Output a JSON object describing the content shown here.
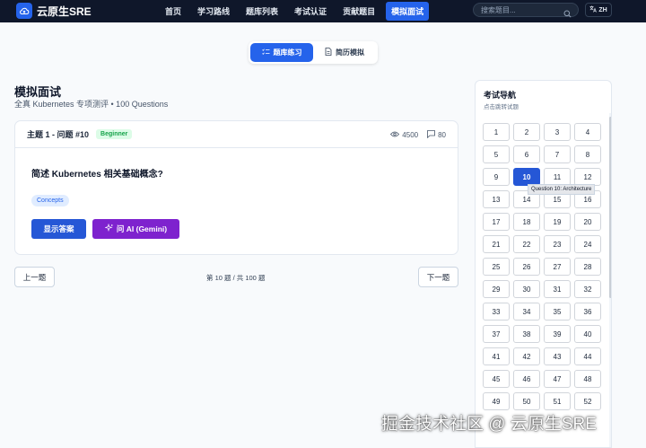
{
  "brand": {
    "name": "云原生SRE"
  },
  "nav": {
    "items": [
      {
        "label": "首页"
      },
      {
        "label": "学习路线"
      },
      {
        "label": "题库列表"
      },
      {
        "label": "考试认证"
      },
      {
        "label": "贡献题目"
      },
      {
        "label": "模拟面试"
      }
    ],
    "active_index": 5,
    "search_placeholder": "搜索题目...",
    "lang_label": "ZH"
  },
  "tabs": {
    "items": [
      {
        "label": "题库练习",
        "icon": "list-check-icon"
      },
      {
        "label": "简历模拟",
        "icon": "document-icon"
      }
    ],
    "active_index": 0
  },
  "header": {
    "title": "模拟面试",
    "subtitle": "全真 Kubernetes 专项测评 • 100 Questions"
  },
  "question": {
    "heading": "主题 1 - 问题 #10",
    "level": "Beginner",
    "views": "4500",
    "comments": "80",
    "text": "简述 Kubernetes 相关基础概念?",
    "tag": "Concepts",
    "show_answer_label": "显示答案",
    "ask_ai_label": "问 AI (Gemini)"
  },
  "pager": {
    "prev_label": "上一题",
    "info": "第 10 题 / 共 100 题",
    "next_label": "下一题"
  },
  "exam_nav": {
    "title": "考试导航",
    "subtitle": "点击跳转试题",
    "current": 10,
    "tooltip": "Question 10: Architecture",
    "numbers": [
      "1",
      "2",
      "3",
      "4",
      "5",
      "6",
      "7",
      "8",
      "9",
      "10",
      "11",
      "12",
      "13",
      "14",
      "15",
      "16",
      "17",
      "18",
      "19",
      "20",
      "21",
      "22",
      "23",
      "24",
      "25",
      "26",
      "27",
      "28",
      "29",
      "30",
      "31",
      "32",
      "33",
      "34",
      "35",
      "36",
      "37",
      "38",
      "39",
      "40",
      "41",
      "42",
      "43",
      "44",
      "45",
      "46",
      "47",
      "48",
      "49",
      "50",
      "51",
      "52"
    ]
  },
  "colors": {
    "navbar_bg": "#0f172a",
    "accent": "#2563eb",
    "ai_purple": "#7e22ce",
    "beginner_green": "#16a34a"
  },
  "watermark": "掘金技术社区 @ 云原生SRE"
}
